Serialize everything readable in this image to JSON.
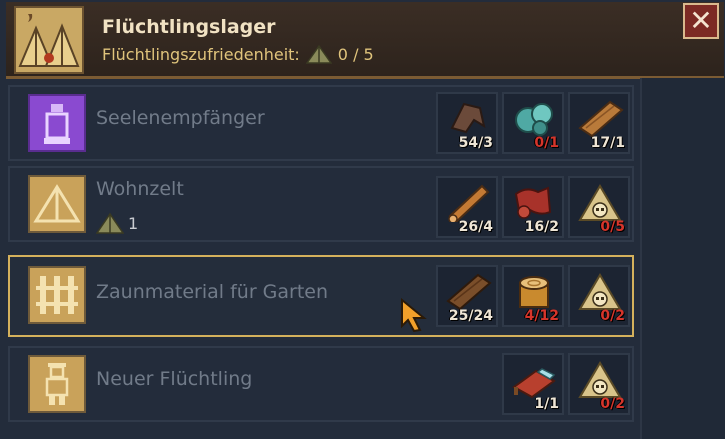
{
  "header": {
    "title": "Flüchtlingslager",
    "satisfaction_label": "Flüchtlingszufriedenheit:",
    "satisfaction_value": "0 / 5",
    "close_glyph": "✕"
  },
  "rows": [
    {
      "label": "Seelenempfänger",
      "icon": "soul-receiver-icon",
      "resources": [
        {
          "icon": "leather-icon",
          "qty": "54/3",
          "short": false
        },
        {
          "icon": "glass-icon",
          "qty": "0/1",
          "short": true
        },
        {
          "icon": "plank-icon",
          "qty": "17/1",
          "short": false
        }
      ]
    },
    {
      "label": "Wohnzelt",
      "icon": "tent-icon",
      "sub_value": "1",
      "resources": [
        {
          "icon": "log-icon",
          "qty": "26/4",
          "short": false
        },
        {
          "icon": "cloth-icon",
          "qty": "16/2",
          "short": false
        },
        {
          "icon": "tent-skull-icon",
          "qty": "0/5",
          "short": true
        }
      ]
    },
    {
      "label": "Zaunmaterial für Garten",
      "icon": "fence-tools-icon",
      "resources": [
        {
          "icon": "plank-icon",
          "qty": "25/24",
          "short": false
        },
        {
          "icon": "stump-icon",
          "qty": "4/12",
          "short": true
        },
        {
          "icon": "tent-skull-icon",
          "qty": "0/2",
          "short": true
        }
      ]
    },
    {
      "label": "Neuer Flüchtling",
      "icon": "refugee-icon",
      "resources": [
        {
          "icon": "bed-icon",
          "qty": "1/1",
          "short": false
        },
        {
          "icon": "tent-skull-icon",
          "qty": "0/2",
          "short": true
        }
      ]
    }
  ],
  "colors": {
    "panel": "#232c3b",
    "header": "#342820",
    "accent_gold": "#d4b15c",
    "shortage_red": "#d6352b",
    "close_red": "#7c2a24"
  }
}
